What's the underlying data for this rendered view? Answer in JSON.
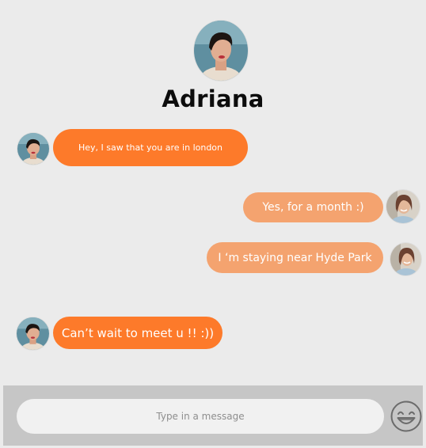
{
  "header": {
    "contact_name": "Adriana",
    "avatar_icon": "contact-avatar"
  },
  "messages": [
    {
      "direction": "incoming",
      "text": "Hey, I saw that you are in london"
    },
    {
      "direction": "outgoing",
      "text": "Yes, for a month :)"
    },
    {
      "direction": "outgoing",
      "text": "I ‘m staying near Hyde Park"
    },
    {
      "direction": "incoming",
      "text": "Can’t wait to meet u !! :))"
    }
  ],
  "composer": {
    "placeholder": "Type in a message",
    "emoji_icon": "smiley-emoji-icon"
  },
  "colors": {
    "background": "#ebebeb",
    "incoming_bubble": "#fd7a2a",
    "outgoing_bubble": "#f4a36f",
    "composer_bar": "#c6c6c6"
  }
}
